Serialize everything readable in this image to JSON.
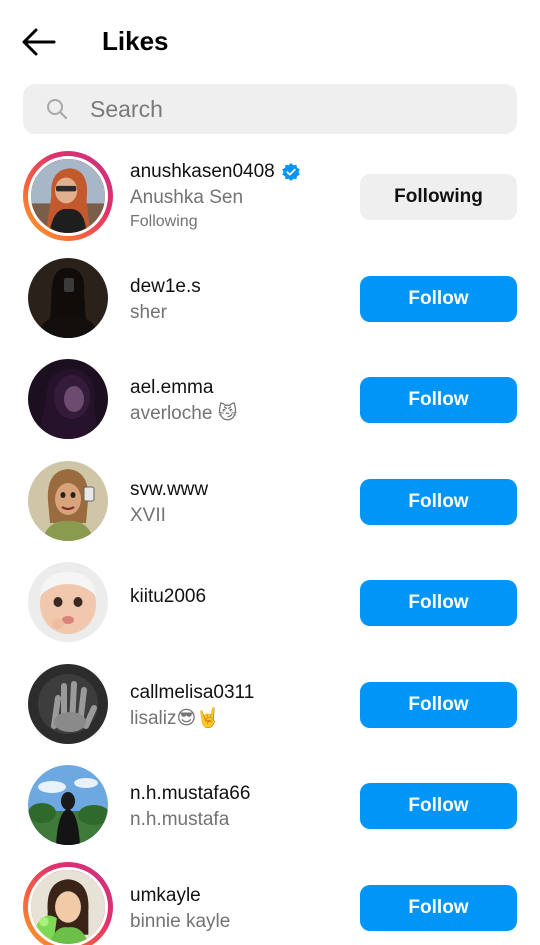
{
  "header": {
    "title": "Likes",
    "back_icon": "arrow-left-icon"
  },
  "search": {
    "placeholder": "Search",
    "icon": "search-icon"
  },
  "colors": {
    "follow_button": "#0095f6",
    "following_button": "#efefef",
    "verified_badge": "#0095f6"
  },
  "users": [
    {
      "username": "anushkasen0408",
      "fullname": "Anushka Sen",
      "subline": "Following",
      "verified": true,
      "story_ring": true,
      "button": "Following"
    },
    {
      "username": "dew1e.s",
      "fullname": "sher",
      "button": "Follow"
    },
    {
      "username": "ael.emma",
      "fullname": "averloche 😼",
      "button": "Follow"
    },
    {
      "username": "svw.www",
      "fullname": "XVII",
      "button": "Follow"
    },
    {
      "username": "kiitu2006",
      "fullname": "",
      "button": "Follow"
    },
    {
      "username": "callmelisa0311",
      "fullname": "lisaliz😎🤘",
      "button": "Follow"
    },
    {
      "username": "n.h.mustafa66",
      "fullname": "n.h.mustafa",
      "button": "Follow"
    },
    {
      "username": "umkayle",
      "fullname": "binnie kayle",
      "story_ring": true,
      "button": "Follow"
    }
  ]
}
